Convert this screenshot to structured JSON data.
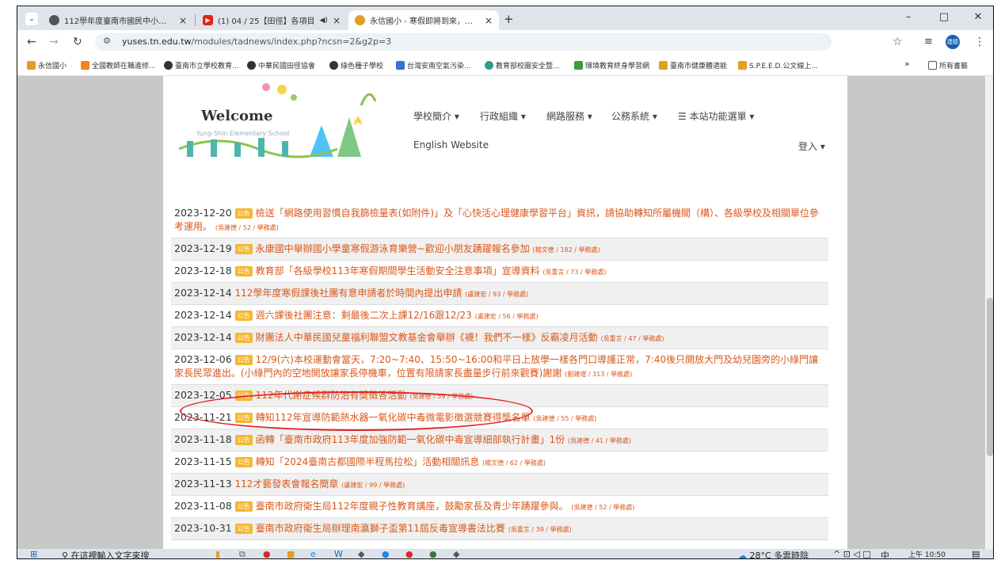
{
  "browser": {
    "tabs": [
      {
        "title": "112學年度臺南市國民中小學田…",
        "favicon": "#555",
        "close": "×"
      },
      {
        "title": "(1) 04 / 25【田徑】各項目",
        "favicon": "#e62117",
        "extra": "◀)",
        "close": "×"
      },
      {
        "title": "永信國小 - 寒假即將到來，為同…",
        "favicon": "#e0a020",
        "close": "×"
      }
    ],
    "new_tab": "+",
    "url_prefix": "yuses.tn.edu.tw",
    "url_rest": "/modules/tadnews/index.php?ncsn=2&g2p=3",
    "profile": "建德",
    "win": {
      "min": "–",
      "max": "□",
      "close": "✕"
    }
  },
  "bookmarks": [
    {
      "label": "永信國小",
      "color": "#e0a020"
    },
    {
      "label": "全國教師在職進修...",
      "color": "#f58220"
    },
    {
      "label": "臺南市立學校教育...",
      "color": "#333"
    },
    {
      "label": "中華民國田徑協會",
      "color": "#333"
    },
    {
      "label": "綠色種子學校",
      "color": "#333"
    },
    {
      "label": "台灣安南空氣污染...",
      "color": "#3a6fd8"
    },
    {
      "label": "教育部校園安全暨...",
      "color": "#2a9d8f"
    },
    {
      "label": "環境教育終身學習網",
      "color": "#3c9b3c"
    },
    {
      "label": "臺南市健康體適能",
      "color": "#e0a020"
    },
    {
      "label": "S.P.E.E.D.公文線上...",
      "color": "#e0a020"
    }
  ],
  "bookmarks_more": "»",
  "bookmarks_folder": "所有書籤",
  "site": {
    "logo_welcome": "Welcome",
    "logo_sub": "Yung-Shin Elementary School",
    "menu": [
      "學校簡介 ▾",
      "行政組織 ▾",
      "網路服務 ▾",
      "公務系統 ▾",
      "本站功能選單 ▾"
    ],
    "english": "English Website",
    "login": "登入 ▾"
  },
  "news": [
    {
      "date": "2023-12-20",
      "badge": "公告",
      "title": "檢送「網路使用習慣自我篩檢量表(如附件)」及「心快活心理健康學習平台」資訊，請協助轉知所屬機關（構）、各級學校及相關單位參考運用。",
      "meta": "(吳建德 / 52 / 學務處)"
    },
    {
      "date": "2023-12-19",
      "badge": "公告",
      "title": "永康國中舉辦國小學童寒假游泳育樂營~歡迎小朋友踴躍報名參加",
      "meta": "(楊文德 / 182 / 學務處)"
    },
    {
      "date": "2023-12-18",
      "badge": "公告",
      "title": "教育部「各級學校113年寒假期間學生活動安全注意事項」宣導資料",
      "meta": "(吳重言 / 73 / 學務處)"
    },
    {
      "date": "2023-12-14",
      "badge": "",
      "title": "112學年度寒假課後社團有意申請者於時間內提出申請",
      "meta": "(盧建宏 / 93 / 學務處)"
    },
    {
      "date": "2023-12-14",
      "badge": "公告",
      "title": "週六課後社團注意：剩最後二次上課12/16跟12/23",
      "meta": "(盧建宏 / 56 / 學務處)"
    },
    {
      "date": "2023-12-14",
      "badge": "公告",
      "title": "財團法人中華民國兒童福利聯盟文教基金會舉辦《襪！我們不一樣》反霸凌月活動",
      "meta": "(吳重言 / 47 / 學務處)"
    },
    {
      "date": "2023-12-06",
      "badge": "公告",
      "title": "12/9(六)本校運動會當天，7:20~7:40、15:50~16:00和平日上放學一樣各門口導護正常，7:40後只開放大門及幼兒園旁的小綠門讓家長民眾進出。(小綠門內的空地開放讓家長停機車，位置有限請家長盡量步行前來觀賽)謝謝",
      "meta": "(劉建增 / 313 / 學務處)"
    },
    {
      "date": "2023-12-05",
      "badge": "公告",
      "title": "112年代謝症候群防治有獎徵答活動",
      "meta": "(吳建德 / 59 / 學務處)"
    },
    {
      "date": "2023-11-21",
      "badge": "公告",
      "title": "轉知112年宣導防範熱水器一氧化碳中毒微電影徵選競賽得獎名單",
      "meta": "(吳建德 / 55 / 學務處)"
    },
    {
      "date": "2023-11-18",
      "badge": "公告",
      "title": "函轉「臺南市政府113年度加強防範一氧化碳中毒宣導細部執行計畫」1份",
      "meta": "(吳建德 / 41 / 學務處)"
    },
    {
      "date": "2023-11-15",
      "badge": "公告",
      "title": "轉知「2024臺南古都國際半程馬拉松」活動相關訊息",
      "meta": "(楊文德 / 62 / 學務處)"
    },
    {
      "date": "2023-11-13",
      "badge": "",
      "title": "112才藝發表會報名簡章",
      "meta": "(盧建宏 / 99 / 學務處)"
    },
    {
      "date": "2023-11-08",
      "badge": "公告",
      "title": "臺南市政府衛生局112年度親子性教育講座，鼓勵家長及青少年踴躍參與。",
      "meta": "(吳建德 / 52 / 學務處)"
    },
    {
      "date": "2023-10-31",
      "badge": "公告",
      "title": "臺南市政府衛生局辦理南瀛獅子盃第11屆反毒宣導書法比賽",
      "meta": "(吳重言 / 39 / 學務處)"
    }
  ],
  "taskbar": {
    "search": "在這裡輸入文字來搜",
    "weather": "28°C 多雲時陰",
    "ime": "中",
    "time": "上午 10:50"
  },
  "colors": {
    "accent": "#d9581c",
    "badge": "#f5b731",
    "highlight_circle": "#e0242a"
  }
}
